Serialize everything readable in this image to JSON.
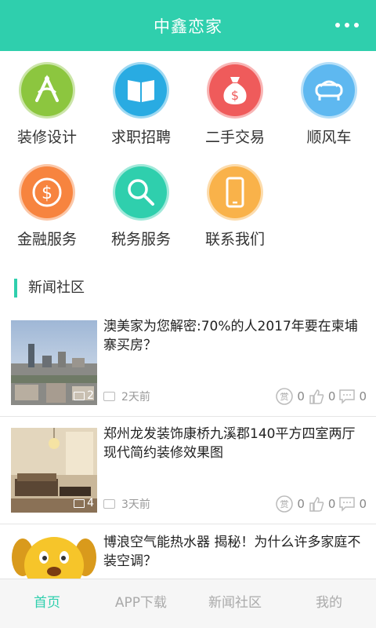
{
  "header": {
    "title": "中鑫恋家"
  },
  "services": [
    {
      "label": "装修设计",
      "icon": "design-compass-icon",
      "color": "#8cc63f"
    },
    {
      "label": "求职招聘",
      "icon": "book-icon",
      "color": "#29abe2"
    },
    {
      "label": "二手交易",
      "icon": "money-bag-icon",
      "color": "#ef5b5b"
    },
    {
      "label": "顺风车",
      "icon": "sofa-car-icon",
      "color": "#5eb8f0"
    },
    {
      "label": "金融服务",
      "icon": "dollar-coin-icon",
      "color": "#f7843f"
    },
    {
      "label": "税务服务",
      "icon": "magnifier-icon",
      "color": "#2fcfad"
    },
    {
      "label": "联系我们",
      "icon": "phone-icon",
      "color": "#f9b24a"
    }
  ],
  "section": {
    "title": "新闻社区"
  },
  "news": [
    {
      "title": "澳美家为您解密:70%的人2017年要在柬埔寨买房？",
      "image_count": "2",
      "time": "2天前",
      "reward": "0",
      "likes": "0",
      "comments": "0"
    },
    {
      "title": "郑州龙发装饰康桥九溪郡140平方四室两厅现代简约装修效果图",
      "image_count": "4",
      "time": "3天前",
      "reward": "0",
      "likes": "0",
      "comments": "0"
    },
    {
      "title": "博浪空气能热水器 揭秘！为什么许多家庭不装空调？"
    }
  ],
  "stat_labels": {
    "reward": "赏"
  },
  "tabs": [
    {
      "label": "首页",
      "active": true
    },
    {
      "label": "APP下载",
      "active": false
    },
    {
      "label": "新闻社区",
      "active": false
    },
    {
      "label": "我的",
      "active": false
    }
  ]
}
